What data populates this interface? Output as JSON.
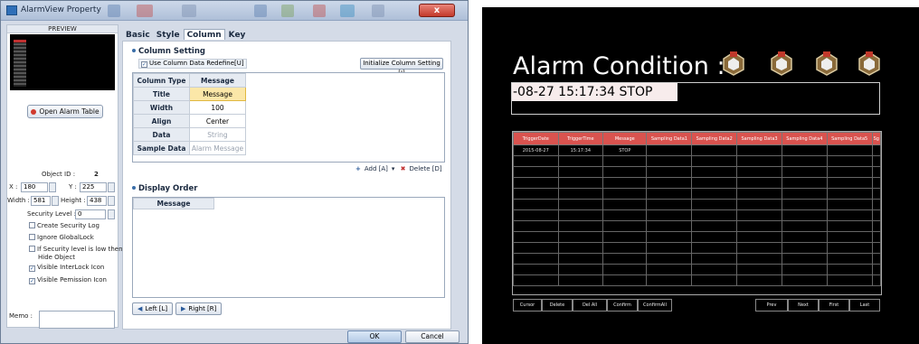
{
  "dialog": {
    "title": "AlarmView Property",
    "close_label": "x",
    "preview_label": "PREVIEW",
    "open_alarm_table": "Open Alarm Table",
    "object_id_label": "Object ID :",
    "object_id": "2",
    "x_label": "X :",
    "x_value": "180",
    "y_label": "Y :",
    "y_value": "225",
    "width_label": "Width :",
    "width_value": "581",
    "height_label": "Height :",
    "height_value": "438",
    "security_label": "Security Level :",
    "security_value": "0",
    "checks": [
      {
        "label": "Create Security Log",
        "checked": false
      },
      {
        "label": "Ignore GlobalLock",
        "checked": false
      },
      {
        "label": "If Security level is low then",
        "label2": "Hide Object",
        "checked": false
      },
      {
        "label": "Visible InterLock Icon",
        "checked": true
      },
      {
        "label": "Visible Pemission Icon",
        "checked": true
      }
    ],
    "memo_label": "Memo :",
    "tabs": [
      "Basic",
      "Style",
      "Column",
      "Key"
    ],
    "column_setting_title": "Column Setting",
    "use_redefine": "Use Column Data Redefine[U]",
    "init_button": "Initialize Column Setting [I]",
    "column_grid": {
      "header": [
        "Column Type",
        "Message"
      ],
      "rows": [
        [
          "Title",
          "Message"
        ],
        [
          "Width",
          "100"
        ],
        [
          "Align",
          "Center"
        ],
        [
          "Data",
          "String"
        ],
        [
          "Sample Data",
          "Alarm Message"
        ]
      ]
    },
    "add_label": "Add [A]",
    "delete_label": "Delete [D]",
    "display_order_title": "Display Order",
    "display_order_header": "Message",
    "left_label": "Left [L]",
    "right_label": "Right [R]",
    "ok_label": "OK",
    "cancel_label": "Cancel"
  },
  "hmi": {
    "title": "Alarm Condition :",
    "last_alarm": "-08-27 15:17:34 STOP",
    "columns": [
      "TriggerDate",
      "TriggerTime",
      "Message",
      "Sampling Data1",
      "Sampling Data2",
      "Sampling Data3",
      "Sampling Data4",
      "Sampling Data5",
      "Sg"
    ],
    "row1": [
      "2015-08-27",
      "15:17:34",
      "STOP",
      "",
      "",
      "",
      "",
      "",
      ""
    ],
    "buttons_left": [
      "Cursor",
      "Delete",
      "Del All",
      "Confirm",
      "ConfirmAll"
    ],
    "buttons_right": [
      "Prev",
      "Next",
      "First",
      "Last"
    ],
    "colors": {
      "header": "#d9534f",
      "background": "#000000"
    }
  }
}
